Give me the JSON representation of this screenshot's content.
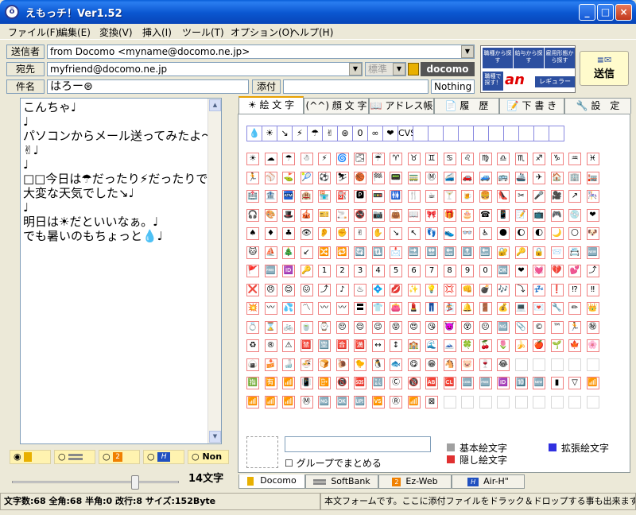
{
  "window": {
    "title": "えもっチ！Ver1.52",
    "app_icon_glyph": "ö"
  },
  "menu": [
    "ファイル(F)",
    "編集(E)",
    "変換(V)",
    "挿入(I)",
    "ツール(T)",
    "オプション(O)",
    "ヘルプ(H)"
  ],
  "header": {
    "from_label": "送信者",
    "from_value": "from Docomo <myname@docomo.ne.jp>",
    "to_label": "宛先",
    "to_value": "myfriend@docomo.ne.jp",
    "priority": "標準",
    "carrier": "docomo",
    "subject_label": "件名",
    "subject_value": "はろー⊛",
    "attach_label": "添付",
    "attach_value": "Nothing",
    "ad_buttons": [
      "職種から探す",
      "給与から探す",
      "雇用形態から探す"
    ],
    "ad_side": "職種で探す！",
    "ad_logo": "an",
    "ad_regular": "レギュラー",
    "send_label": "送信"
  },
  "editor": {
    "text": "こんちゃ♩\n♩\nパソコンからメール送ってみたよ～✌♩\n♩\n□□今日は☂だったり⚡だったりで大変な天気でした↘♩\n♩\n明日は☀だといいなぁ。♩\nでも暑いのもちょっと💧♩\n"
  },
  "carrier_radios": [
    {
      "label": "",
      "icon": "docomo-icon",
      "selected": true
    },
    {
      "label": "",
      "icon": "softbank-icon",
      "selected": false
    },
    {
      "label": "",
      "icon": "ezweb-icon",
      "selected": false
    },
    {
      "label": "",
      "icon": "airh-icon",
      "selected": false
    },
    {
      "label": "Non",
      "icon": "",
      "selected": false
    }
  ],
  "char_count": "14文字",
  "slider_value": 0.75,
  "tabs": [
    "☀ 絵 文 字",
    "(^^) 顔 文 字",
    "📖 アドレス帳",
    "📄 履　歴",
    "📝 下 書 き",
    "🔧 設　定"
  ],
  "history": [
    "💧",
    "☀",
    "↘",
    "⚡",
    "☂",
    "✌",
    "⊛",
    "0",
    "∞",
    "❤",
    "CVS"
  ],
  "emoji_rows": [
    [
      "☀",
      "☁",
      "☂",
      "☃",
      "⚡",
      "🌀",
      "🌫",
      "☔",
      "♈",
      "♉",
      "♊",
      "♋",
      "♌",
      "♍",
      "♎",
      "♏",
      "♐",
      "♑",
      "♒",
      "♓"
    ],
    [
      "🏃",
      "⚾",
      "⛳",
      "🎾",
      "⚽",
      "⛷",
      "🏀",
      "🏁",
      "📟",
      "🚃",
      "Ⓜ",
      "🚄",
      "🚗",
      "🚙",
      "🚌",
      "🚢",
      "✈",
      "🏠",
      "🏢",
      "🏣"
    ],
    [
      "🏥",
      "🏦",
      "🏧",
      "🏨",
      "🏪",
      "⛽",
      "🅿",
      "🚥",
      "🚻",
      "🍴",
      "☕",
      "🍸",
      "🍺",
      "🍔",
      "👠",
      "✂",
      "🎤",
      "🎥",
      "↗",
      "🎠"
    ],
    [
      "🎧",
      "🎨",
      "🎩",
      "🎪",
      "🎫",
      "🚬",
      "🚭",
      "📷",
      "👜",
      "📖",
      "🎀",
      "🎁",
      "🎂",
      "☎",
      "📱",
      "📝",
      "📺",
      "🎮",
      "💿",
      "❤"
    ],
    [
      "♠",
      "♦",
      "♣",
      "👁",
      "👂",
      "✊",
      "✌",
      "✋",
      "↘",
      "↖",
      "👣",
      "👟",
      "👓",
      "♿",
      "🌑",
      "🌔",
      "🌓",
      "🌙",
      "🌕",
      "🐶"
    ],
    [
      "🐱",
      "⛵",
      "🎄",
      "↙",
      "🔀",
      "🔁",
      "🔄",
      "🔃",
      "📩",
      "🔜",
      "🔛",
      "🔚",
      "🔝",
      "🔙",
      "🔐",
      "🔑",
      "🔒",
      "📨",
      "📇",
      "🆕"
    ],
    [
      "🚩",
      "🆓",
      "🆔",
      "🔑",
      "1",
      "2",
      "3",
      "4",
      "5",
      "6",
      "7",
      "8",
      "9",
      "0",
      "🆗",
      "❤",
      "💓",
      "💔",
      "💕",
      "⤴"
    ],
    [
      "❌",
      "😠",
      "😊",
      "😖",
      "⤴",
      "♪",
      "♨",
      "💠",
      "💋",
      "✨",
      "💡",
      "💢",
      "👊",
      "💣",
      "🎶",
      "⤵",
      "💤",
      "❗",
      "⁉",
      "‼"
    ],
    [
      "💥",
      "〰",
      "💦",
      "〽",
      "〰",
      "〰",
      "〓",
      "👕",
      "👛",
      "💄",
      "👖",
      "🏂",
      "🔔",
      "🚪",
      "💰",
      "💻",
      "💌",
      "🔧",
      "✏",
      "👑"
    ],
    [
      "💍",
      "⌛",
      "🚲",
      "🍵",
      "⌚",
      "😔",
      "😌",
      "😉",
      "😝",
      "😍",
      "😘",
      "👿",
      "😵",
      "😐",
      "🆖",
      "📎",
      "©",
      "™",
      "🏃",
      "㊙"
    ],
    [
      "♻",
      "®",
      "⚠",
      "🈲",
      "🈳",
      "🈴",
      "🈵",
      "↔",
      "↕",
      "🏫",
      "🌊",
      "🗻",
      "🍀",
      "🍒",
      "🌷",
      "🍌",
      "🍎",
      "🌱",
      "🍁",
      "🌸"
    ],
    [
      "🍙",
      "🍰",
      "🍶",
      "🍜",
      "🍞",
      "🐌",
      "🐤",
      "🐧",
      "🐟",
      "😋",
      "😁",
      "🐴",
      "🐷",
      "🍷",
      "😂"
    ],
    [
      "🈯",
      "🈶",
      "📶",
      "📳",
      "📴",
      "📵",
      "🆘",
      "🔣",
      "Ⓒ",
      "🔞",
      "🆎",
      "🆑",
      "🆒",
      "🆓",
      "🆔",
      "🔟",
      "🆕",
      "▮",
      "▽",
      "📶"
    ],
    [
      "📶",
      "📶",
      "📶",
      "Ⓜ",
      "🆖",
      "🆗",
      "🆙",
      "🆚",
      "Ⓡ",
      "📶",
      "⊠"
    ]
  ],
  "preview_input": "",
  "group_label": "グループでまとめる",
  "legend": [
    {
      "label": "基本絵文字",
      "color": "#a0a0a0"
    },
    {
      "label": "拡張絵文字",
      "color": "#3030e0"
    },
    {
      "label": "隠し絵文字",
      "color": "#e03030"
    }
  ],
  "bottom_tabs": [
    "Docomo",
    "SoftBank",
    "Ez-Web",
    "Air-H\""
  ],
  "status": {
    "stats": "文字数:68 全角:68 半角:0 改行:8 サイズ:152Byte",
    "hint": "本文フォームです。ここに添付ファイルをドラック＆ドロップする事も出来ます。"
  }
}
